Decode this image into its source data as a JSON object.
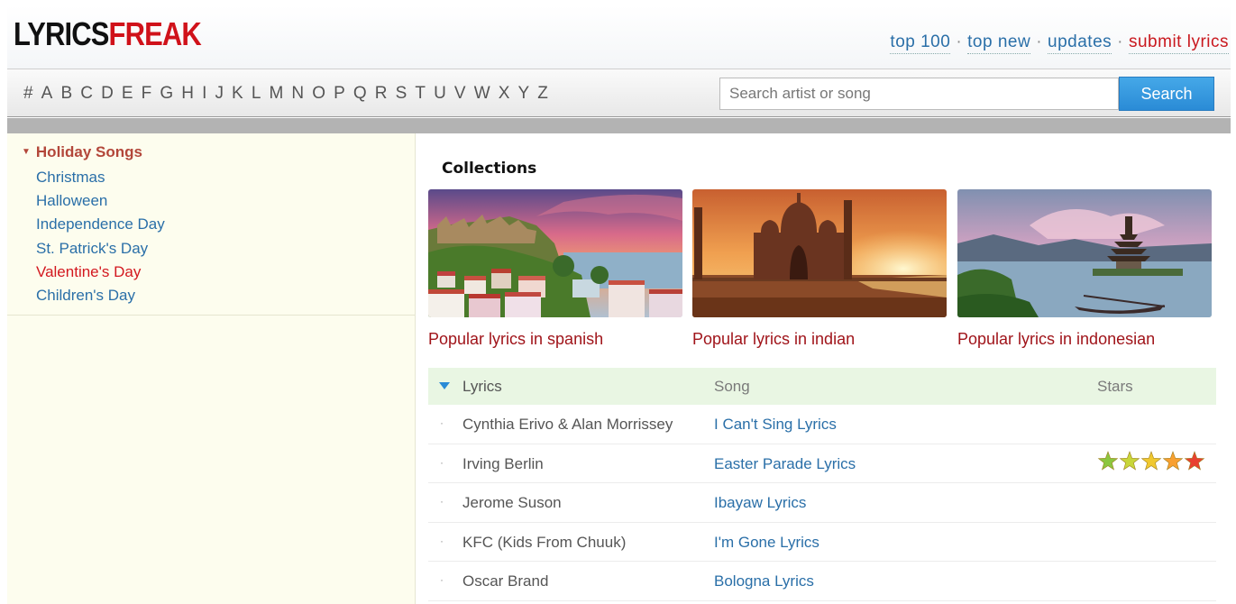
{
  "header": {
    "logo_part1": "LYRICS",
    "logo_part2": "FREAK",
    "nav": [
      "top 100",
      "top new",
      "updates",
      "submit lyrics"
    ],
    "nav_separator": "·"
  },
  "alphabet": [
    "#",
    "A",
    "B",
    "C",
    "D",
    "E",
    "F",
    "G",
    "H",
    "I",
    "J",
    "K",
    "L",
    "M",
    "N",
    "O",
    "P",
    "Q",
    "R",
    "S",
    "T",
    "U",
    "V",
    "W",
    "X",
    "Y",
    "Z"
  ],
  "search": {
    "placeholder": "Search artist or song",
    "button_label": "Search"
  },
  "sidebar": {
    "heading": "Holiday Songs",
    "items": [
      "Christmas",
      "Halloween",
      "Independence Day",
      "St. Patrick's Day",
      "Valentine's Day",
      "Children's Day"
    ],
    "active_item": "Valentine's Day"
  },
  "collections": {
    "title": "Collections",
    "items": [
      {
        "caption": "Popular lyrics in spanish",
        "image": "lisbon-castle-city-photo"
      },
      {
        "caption": "Popular lyrics in indian",
        "image": "taj-mahal-sunset-photo"
      },
      {
        "caption": "Popular lyrics in indonesian",
        "image": "bali-temple-lake-photo"
      }
    ]
  },
  "lyrics_table": {
    "headers": {
      "artist": "Lyrics",
      "song": "Song",
      "stars": "Stars"
    },
    "rows": [
      {
        "artist": "Cynthia Erivo & Alan Morrissey",
        "song": "I Can't Sing Lyrics",
        "stars": 0
      },
      {
        "artist": "Irving Berlin",
        "song": "Easter Parade Lyrics",
        "stars": 5
      },
      {
        "artist": "Jerome Suson",
        "song": "Ibayaw Lyrics",
        "stars": 0
      },
      {
        "artist": "KFC (Kids From Chuuk)",
        "song": "I'm Gone Lyrics",
        "stars": 0
      },
      {
        "artist": "Oscar Brand",
        "song": "Bologna Lyrics",
        "stars": 0
      }
    ]
  },
  "colors": {
    "brand_red": "#d0121a",
    "link_blue": "#2a6fa8",
    "caption_red": "#a0141a",
    "search_button": "#2a8bd6",
    "sidebar_bg": "#fdfdee",
    "table_header_bg": "#e9f6e3"
  }
}
